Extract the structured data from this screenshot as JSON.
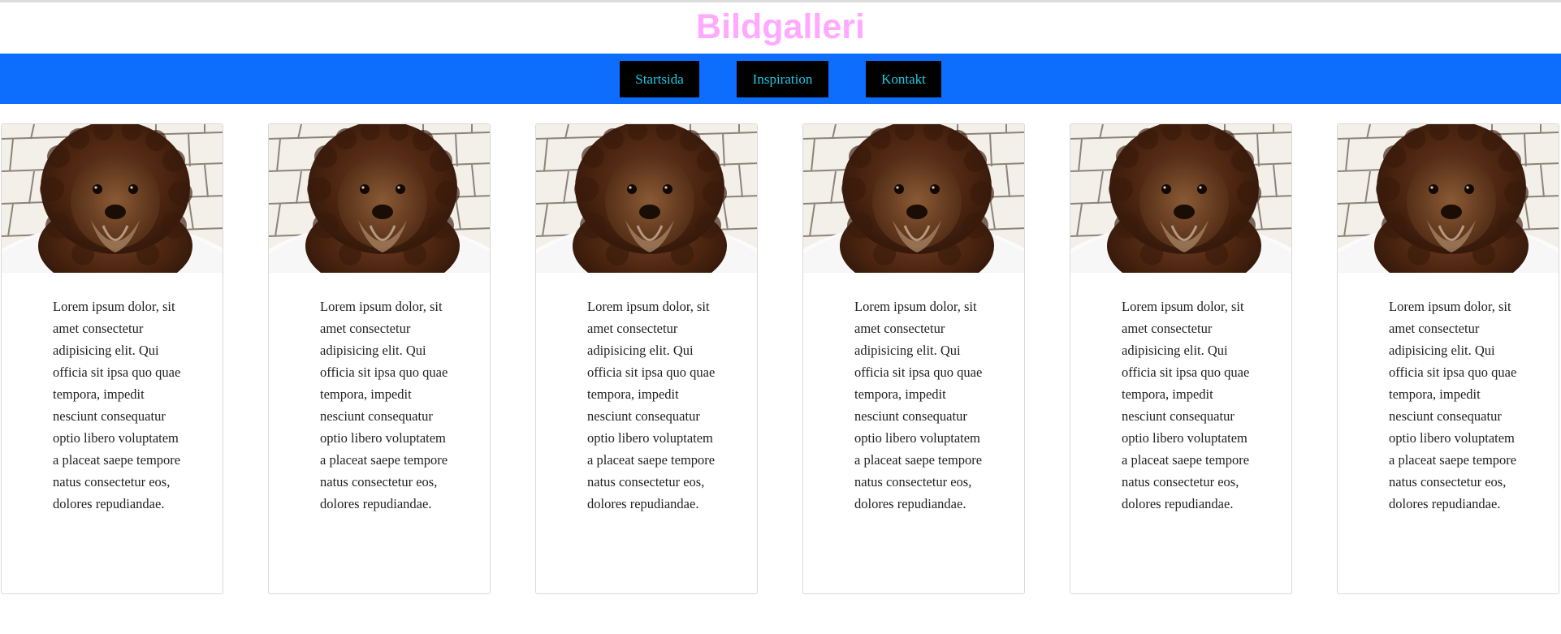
{
  "site": {
    "title": "Bildgalleri"
  },
  "nav": {
    "items": [
      {
        "label": "Startsida"
      },
      {
        "label": "Inspiration"
      },
      {
        "label": "Kontakt"
      }
    ]
  },
  "colors": {
    "title": "#ffaaff",
    "navbar_bg": "#0d6efd",
    "nav_button_bg": "#000000",
    "nav_button_text": "#1fc7e0"
  },
  "gallery": {
    "cards": [
      {
        "image": "curly-brown-dog-photo",
        "text": "Lorem ipsum dolor, sit amet consectetur adipisicing elit. Qui officia sit ipsa quo quae tempora, impedit nesciunt consequatur optio libero voluptatem a placeat saepe tempore natus consectetur eos, dolores repudiandae."
      },
      {
        "image": "curly-brown-dog-photo",
        "text": "Lorem ipsum dolor, sit amet consectetur adipisicing elit. Qui officia sit ipsa quo quae tempora, impedit nesciunt consequatur optio libero voluptatem a placeat saepe tempore natus consectetur eos, dolores repudiandae."
      },
      {
        "image": "curly-brown-dog-photo",
        "text": "Lorem ipsum dolor, sit amet consectetur adipisicing elit. Qui officia sit ipsa quo quae tempora, impedit nesciunt consequatur optio libero voluptatem a placeat saepe tempore natus consectetur eos, dolores repudiandae."
      },
      {
        "image": "curly-brown-dog-photo",
        "text": "Lorem ipsum dolor, sit amet consectetur adipisicing elit. Qui officia sit ipsa quo quae tempora, impedit nesciunt consequatur optio libero voluptatem a placeat saepe tempore natus consectetur eos, dolores repudiandae."
      },
      {
        "image": "curly-brown-dog-photo",
        "text": "Lorem ipsum dolor, sit amet consectetur adipisicing elit. Qui officia sit ipsa quo quae tempora, impedit nesciunt consequatur optio libero voluptatem a placeat saepe tempore natus consectetur eos, dolores repudiandae."
      },
      {
        "image": "curly-brown-dog-photo",
        "text": "Lorem ipsum dolor, sit amet consectetur adipisicing elit. Qui officia sit ipsa quo quae tempora, impedit nesciunt consequatur optio libero voluptatem a placeat saepe tempore natus consectetur eos, dolores repudiandae."
      }
    ]
  }
}
